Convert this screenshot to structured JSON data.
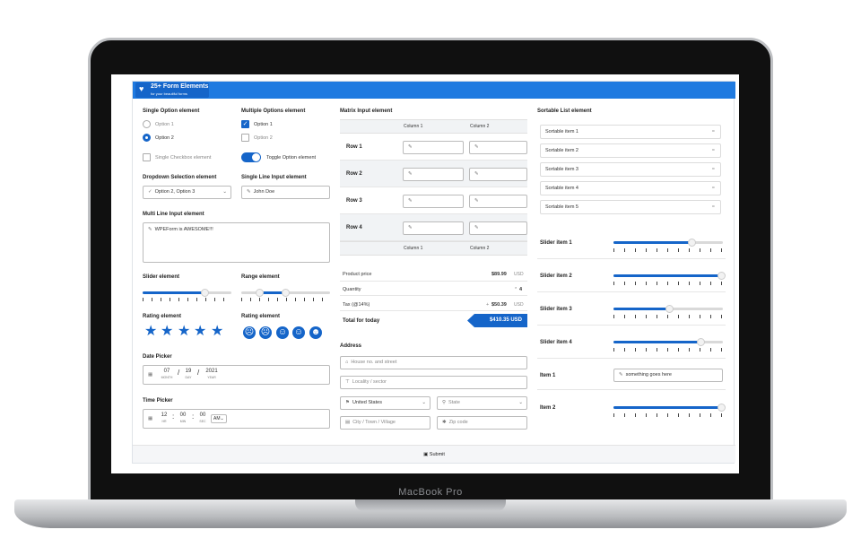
{
  "device": {
    "brand": "MacBook Pro"
  },
  "header": {
    "title": "25+ Form Elements",
    "subtitle": "for your beautiful forms",
    "icon": "heart-icon",
    "accent": "#1565c9"
  },
  "col1": {
    "single_option": {
      "label": "Single Option element",
      "options": [
        "Option 1",
        "Option 2"
      ],
      "selected": "Option 2"
    },
    "multiple_options": {
      "label": "Multiple Options element",
      "options": [
        "Option 1",
        "Option 2"
      ],
      "checked": [
        "Option 1"
      ]
    },
    "single_checkbox": {
      "label": "Single Checkbox element"
    },
    "toggle": {
      "label": "Toggle Option element",
      "on": true
    },
    "dropdown": {
      "label": "Dropdown Selection element",
      "value": "Option 2, Option 3"
    },
    "single_line": {
      "label": "Single Line Input element",
      "value": "John Doe"
    },
    "multi_line": {
      "label": "Multi Line Input element",
      "value": "WPEForm is AWESOME!!!"
    },
    "slider": {
      "label": "Slider element",
      "value_fraction": 0.7
    },
    "range": {
      "label": "Range element",
      "low_fraction": 0.2,
      "high_fraction": 0.5
    },
    "rating_stars": {
      "label": "Rating element",
      "value": 5,
      "max": 5
    },
    "rating_faces": {
      "label": "Rating element",
      "faces": [
        "angry-face-icon",
        "sad-face-icon",
        "neutral-face-icon",
        "smile-face-icon",
        "happy-face-icon"
      ]
    },
    "date_picker": {
      "label": "Date Picker",
      "month": "07",
      "day": "19",
      "year": "2021",
      "month_label": "MONTH",
      "day_label": "DAY",
      "year_label": "YEAR"
    },
    "time_picker": {
      "label": "Time Picker",
      "hour": "12",
      "minute": "00",
      "second": "00",
      "ampm": "AM",
      "hour_label": "HR",
      "minute_label": "MIN",
      "second_label": "SEC"
    }
  },
  "matrix": {
    "label": "Matrix Input element",
    "columns": [
      "Column 1",
      "Column 2"
    ],
    "rows": [
      "Row 1",
      "Row 2",
      "Row 3",
      "Row 4"
    ]
  },
  "summary": {
    "rows": [
      {
        "label": "Product price",
        "value": "$89.99",
        "unit": "USD"
      },
      {
        "label": "Quantity",
        "value": "4",
        "prefix": "*"
      },
      {
        "label": "Tax (@14%)",
        "value": "$50.39",
        "unit": "USD",
        "prefix": "+"
      }
    ],
    "total_label": "Total for today",
    "total_value": "$410.35 USD"
  },
  "address": {
    "label": "Address",
    "house_placeholder": "House no. and street",
    "locality_placeholder": "Locality / sector",
    "country": "United States",
    "state_placeholder": "State",
    "city_placeholder": "City / Town / Village",
    "zip_placeholder": "Zip code"
  },
  "sortable": {
    "label": "Sortable List element",
    "items": [
      "Sortable item 1",
      "Sortable item 2",
      "Sortable item 3",
      "Sortable item 4",
      "Sortable item 5"
    ]
  },
  "sliders": [
    {
      "label": "Slider item 1",
      "value_fraction": 0.72
    },
    {
      "label": "Slider item 2",
      "value_fraction": 1.0
    },
    {
      "label": "Slider item 3",
      "value_fraction": 0.51
    },
    {
      "label": "Slider item 4",
      "value_fraction": 0.8
    }
  ],
  "item1": {
    "label": "Item 1",
    "value": "something goes here"
  },
  "item2": {
    "label": "Item 2",
    "value_fraction": 1.0
  },
  "footer": {
    "submit_label": "Submit"
  }
}
